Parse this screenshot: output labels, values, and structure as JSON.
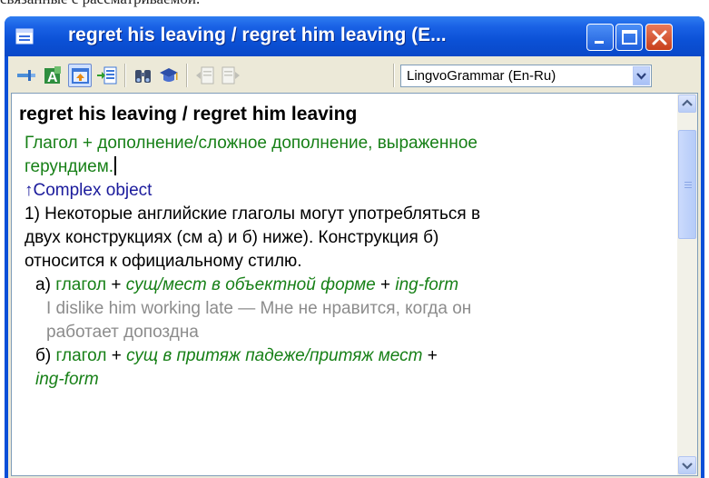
{
  "background_caption": "связанные с рассматриваемой.",
  "window": {
    "title": "regret his leaving / regret him leaving (E..."
  },
  "toolbar": {
    "buttons": [
      {
        "name": "pin",
        "icon": "pin-icon"
      },
      {
        "name": "translate",
        "icon": "dictionary-a-icon"
      },
      {
        "name": "card-view",
        "icon": "card-upload-icon",
        "pressed": true
      },
      {
        "name": "list",
        "icon": "list-arrow-icon"
      },
      {
        "name": "find",
        "icon": "binoculars-icon"
      },
      {
        "name": "learn",
        "icon": "graduation-cap-icon"
      },
      {
        "name": "back",
        "icon": "back-page-icon",
        "disabled": true
      },
      {
        "name": "forward",
        "icon": "forward-page-icon",
        "disabled": true
      }
    ],
    "dictionary_select": "LingvoGrammar (En-Ru)"
  },
  "entry": {
    "heading": "regret his leaving / regret him leaving",
    "definition_line1": "Глагол + дополнение/сложное дополнение, выраженное",
    "definition_line2": "герундием.",
    "link": "↑Complex object",
    "p1_line1": "1) Некоторые английские глаголы могут употребляться в",
    "p1_line2": "двух конструкциях (см а) и б) ниже). Конструкция б)",
    "p1_line3": "относится к официальному стилю.",
    "a_marker": "а)",
    "a_verb": "глагол",
    "plus": "+",
    "a_object": "сущ/мест в объектной форме",
    "ing_form": "ing-form",
    "example_line1": "I dislike him working late — Мне не нравится, когда он",
    "example_line2": "работает допоздна",
    "b_marker": "б)",
    "b_verb": "глагол",
    "b_object": "сущ в притяж падеже/притяж мест"
  }
}
